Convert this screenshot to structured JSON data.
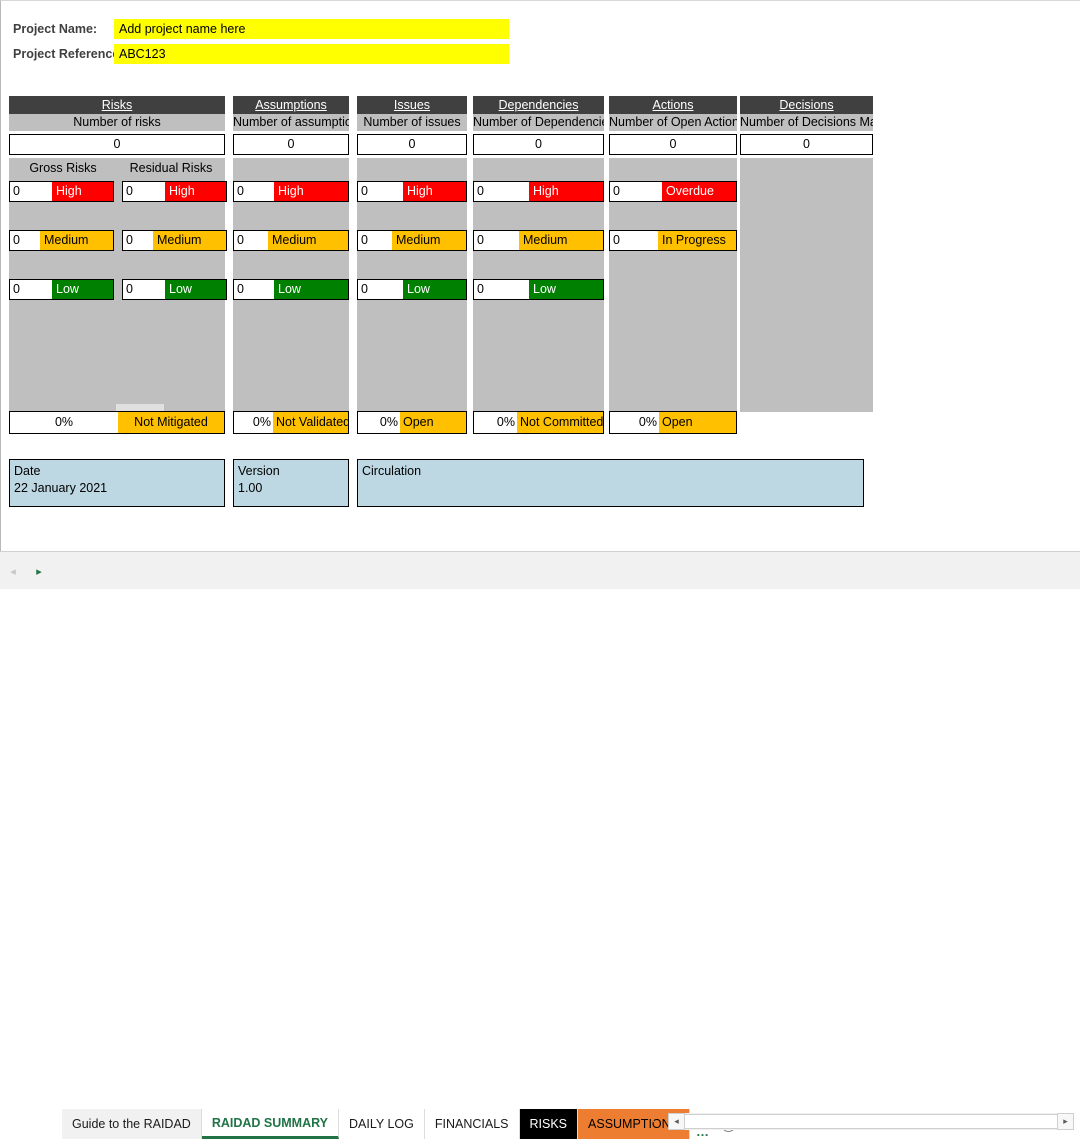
{
  "project": {
    "name_label": "Project Name:",
    "name_value": "Add project name here",
    "ref_label": "Project Reference:",
    "ref_value": "ABC123",
    "highlight_color": "#ffff00"
  },
  "colors": {
    "header_bg": "#404040",
    "subheader_bg": "#bfbfbf",
    "high": "#ff0000",
    "medium": "#ffc000",
    "low": "#008000",
    "info_box": "#bdd7e3",
    "excel_green": "#217346",
    "tab_orange": "#ed7d31"
  },
  "columns": [
    {
      "key": "risks",
      "title": "Risks",
      "subtitle": "Number of risks",
      "total": "0",
      "split_labels": [
        "Gross Risks",
        "Residual Risks"
      ],
      "gross": [
        {
          "count": "0",
          "label": "High",
          "severity": "high"
        },
        {
          "count": "0",
          "label": "Medium",
          "severity": "medium"
        },
        {
          "count": "0",
          "label": "Low",
          "severity": "low"
        }
      ],
      "residual": [
        {
          "count": "0",
          "label": "High",
          "severity": "high"
        },
        {
          "count": "0",
          "label": "Medium",
          "severity": "medium"
        },
        {
          "count": "0",
          "label": "Low",
          "severity": "low"
        }
      ],
      "percent": {
        "value": "0%",
        "label": "Not Mitigated",
        "label_align": "center"
      }
    },
    {
      "key": "assumptions",
      "title": "Assumptions",
      "subtitle": "Number of assumptions",
      "total": "0",
      "ratings": [
        {
          "count": "0",
          "label": "High",
          "severity": "high"
        },
        {
          "count": "0",
          "label": "Medium",
          "severity": "medium"
        },
        {
          "count": "0",
          "label": "Low",
          "severity": "low"
        }
      ],
      "percent": {
        "value": "0%",
        "label": "Not Validated",
        "label_align": "left"
      }
    },
    {
      "key": "issues",
      "title": "Issues",
      "subtitle": "Number of issues",
      "total": "0",
      "ratings": [
        {
          "count": "0",
          "label": "High",
          "severity": "high"
        },
        {
          "count": "0",
          "label": "Medium",
          "severity": "medium"
        },
        {
          "count": "0",
          "label": "Low",
          "severity": "low"
        }
      ],
      "percent": {
        "value": "0%",
        "label": "Open",
        "label_align": "left"
      }
    },
    {
      "key": "dependencies",
      "title": "Dependencies",
      "subtitle": "Number of Dependencies",
      "total": "0",
      "ratings": [
        {
          "count": "0",
          "label": "High",
          "severity": "high"
        },
        {
          "count": "0",
          "label": "Medium",
          "severity": "medium"
        },
        {
          "count": "0",
          "label": "Low",
          "severity": "low"
        }
      ],
      "percent": {
        "value": "0%",
        "label": "Not Committed",
        "label_align": "left"
      }
    },
    {
      "key": "actions",
      "title": "Actions",
      "subtitle": "Number of Open Actions",
      "total": "0",
      "ratings": [
        {
          "count": "0",
          "label": "Overdue",
          "severity": "high"
        },
        {
          "count": "0",
          "label": "In Progress",
          "severity": "medium"
        }
      ],
      "percent": {
        "value": "0%",
        "label": "Open",
        "label_align": "left"
      }
    },
    {
      "key": "decisions",
      "title": "Decisions",
      "subtitle": "Number of Decisions Made",
      "total": "0",
      "ratings": [],
      "percent": null
    }
  ],
  "footer": [
    {
      "key": "date",
      "label": "Date",
      "value": "22 January 2021"
    },
    {
      "key": "version",
      "label": "Version",
      "value": "1.00"
    },
    {
      "key": "circulation",
      "label": "Circulation",
      "value": ""
    }
  ],
  "tabbar": {
    "prev_arrow": "◂",
    "next_arrow": "▸",
    "tabs": [
      {
        "label": "Guide to the RAIDAD",
        "style": "inactive-grey"
      },
      {
        "label": "RAIDAD SUMMARY",
        "style": "active"
      },
      {
        "label": "DAILY LOG",
        "style": "inactive-white"
      },
      {
        "label": "FINANCIALS",
        "style": "inactive-white"
      },
      {
        "label": "RISKS",
        "style": "black"
      },
      {
        "label": "ASSUMPTIONS",
        "style": "orange"
      }
    ],
    "overflow": "…",
    "add_sheet": "+",
    "grip": "⋮",
    "scroll_left": "◂",
    "scroll_right": "▸"
  }
}
